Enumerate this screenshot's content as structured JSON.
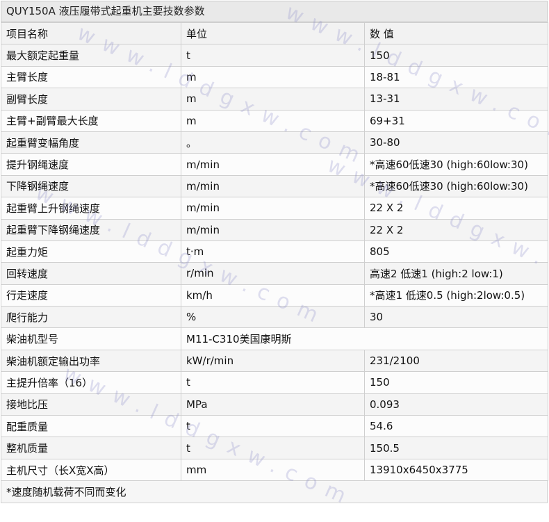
{
  "title": "QUY150A 液压履带式起重机主要技数参数",
  "headers": [
    "项目名称",
    "单位",
    "数 值"
  ],
  "rows": [
    [
      "最大额定起重量",
      "t",
      "150"
    ],
    [
      "主臂长度",
      "m",
      "18-81"
    ],
    [
      "副臂长度",
      "m",
      "13-31"
    ],
    [
      "主臂+副臂最大长度",
      "m",
      "69+31"
    ],
    [
      "起重臂变幅角度",
      "。",
      "30-80"
    ],
    [
      "提升钢绳速度",
      "m/min",
      "*高速60低速30 (high:60low:30)"
    ],
    [
      "下降钢绳速度",
      "m/min",
      "*高速60低速30 (high:60low:30)"
    ],
    [
      "起重臂上升钢绳速度",
      "m/min",
      "22 X 2"
    ],
    [
      "起重臂下降钢绳速度",
      "m/min",
      "22 X 2"
    ],
    [
      "起重力矩",
      "t·m",
      "805"
    ],
    [
      "回转速度",
      "r/min",
      "高速2 低速1 (high:2 low:1)"
    ],
    [
      "行走速度",
      "km/h",
      "*高速1 低速0.5 (high:2low:0.5)"
    ],
    [
      "爬行能力",
      "%",
      "30"
    ],
    [
      "柴油机型号",
      "M11-C310美国康明斯",
      ""
    ],
    [
      "柴油机额定输出功率",
      "kW/r/min",
      "231/2100"
    ],
    [
      "主提升倍率（16）",
      "t",
      "150"
    ],
    [
      "接地比压",
      "MPa",
      "0.093"
    ],
    [
      "配重质量",
      "t",
      "54.6"
    ],
    [
      "整机质量",
      "t",
      "150.5"
    ],
    [
      "主机尺寸（长X宽X高）",
      "mm",
      "13910x6450x3775"
    ]
  ],
  "footnote": "*速度随机载荷不同而变化",
  "watermark": "www.lddgxw.com"
}
